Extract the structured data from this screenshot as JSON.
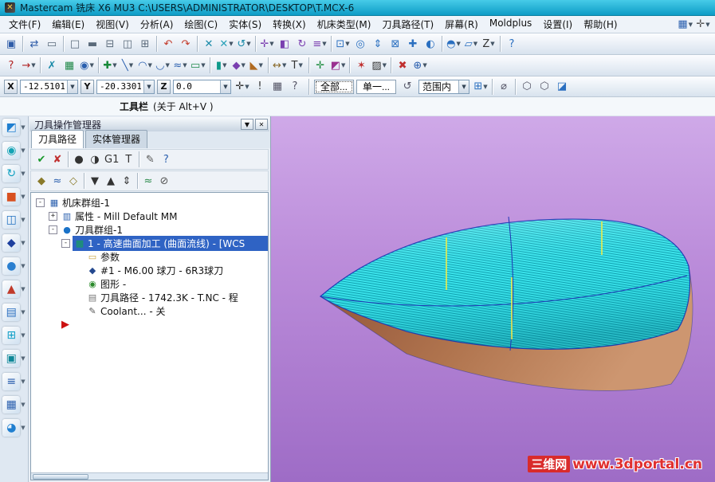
{
  "window": {
    "title": "Mastercam 铣床 X6 MU3  C:\\USERS\\ADMINISTRATOR\\DESKTOP\\T.MCX-6"
  },
  "menubar": {
    "items": [
      "文件(F)",
      "编辑(E)",
      "视图(V)",
      "分析(A)",
      "绘图(C)",
      "实体(S)",
      "转换(X)",
      "机床类型(M)",
      "刀具路径(T)",
      "屏幕(R)",
      "Moldplus",
      "设置(I)",
      "帮助(H)"
    ],
    "right_icons": [
      {
        "name": "toolbar-states",
        "glyph": "▦",
        "color": "#2a5fae",
        "dd": true
      },
      {
        "name": "customize",
        "glyph": "✛",
        "color": "#555",
        "dd": true
      }
    ]
  },
  "toolbar1": {
    "icons": [
      {
        "name": "save",
        "glyph": "▣",
        "color": "#2e5ca8"
      },
      {
        "sep": true
      },
      {
        "name": "file-convert",
        "glyph": "⇄",
        "color": "#2e5ca8"
      },
      {
        "name": "print",
        "glyph": "▭",
        "color": "#5a6a7a"
      },
      {
        "sep": true
      },
      {
        "name": "screen-clear",
        "glyph": "□",
        "color": "#5a6a7a"
      },
      {
        "name": "viewport-single",
        "glyph": "▬",
        "color": "#5a6a7a"
      },
      {
        "name": "viewport-split-h",
        "glyph": "⊟",
        "color": "#5a6a7a"
      },
      {
        "name": "viewport-split-v",
        "glyph": "◫",
        "color": "#5a6a7a"
      },
      {
        "name": "viewport-quad",
        "glyph": "⊞",
        "color": "#5a6a7a"
      },
      {
        "sep": true
      },
      {
        "name": "undo",
        "glyph": "↶",
        "color": "#c23a2a"
      },
      {
        "name": "redo",
        "glyph": "↷",
        "color": "#c23a2a"
      },
      {
        "sep": true
      },
      {
        "name": "delete-entities",
        "glyph": "✕",
        "color": "#1a8aa8"
      },
      {
        "name": "delete-duplicates",
        "glyph": "✕",
        "color": "#28a0b8",
        "dd": true
      },
      {
        "name": "undelete",
        "glyph": "↺",
        "color": "#1a8aa8",
        "dd": true
      },
      {
        "sep": true
      },
      {
        "name": "xform-translate",
        "glyph": "✛",
        "color": "#7a3fb0",
        "dd": true
      },
      {
        "name": "xform-mirror",
        "glyph": "◧",
        "color": "#7a3fb0"
      },
      {
        "name": "xform-rotate",
        "glyph": "↻",
        "color": "#7a3fb0"
      },
      {
        "name": "xform-offset",
        "glyph": "≡",
        "color": "#7a3fb0",
        "dd": true
      },
      {
        "sep": true
      },
      {
        "name": "zoom-window",
        "glyph": "⊡",
        "color": "#2a6fc0",
        "dd": true
      },
      {
        "name": "zoom-target",
        "glyph": "◎",
        "color": "#2a6fc0"
      },
      {
        "name": "zoom-in-out",
        "glyph": "⇕",
        "color": "#2a6fc0"
      },
      {
        "name": "zoom-fit",
        "glyph": "⊠",
        "color": "#2a6fc0"
      },
      {
        "name": "pan",
        "glyph": "✚",
        "color": "#2a6fc0"
      },
      {
        "name": "repaint",
        "glyph": "◐",
        "color": "#2a6fc0"
      },
      {
        "sep": true
      },
      {
        "name": "gview-combo",
        "glyph": "◓",
        "color": "#2a6fc0",
        "dd": true
      },
      {
        "name": "planes-combo",
        "glyph": "▱",
        "color": "#2a6fc0",
        "dd": true
      },
      {
        "name": "z-depth",
        "glyph": "Z",
        "color": "#333",
        "dd": true
      },
      {
        "sep": true
      },
      {
        "name": "help",
        "glyph": "?",
        "color": "#2a6fc0"
      }
    ]
  },
  "toolbar2": {
    "icons": [
      {
        "name": "analyze-position",
        "glyph": "?",
        "color": "#b02020"
      },
      {
        "name": "analyze-dynamic",
        "glyph": "→",
        "color": "#b02020",
        "dd": true
      },
      {
        "sep": true
      },
      {
        "name": "delete-entity",
        "glyph": "✗",
        "color": "#1a8aa8"
      },
      {
        "name": "select-result",
        "glyph": "▦",
        "color": "#238a4a"
      },
      {
        "name": "curve-edit",
        "glyph": "◉",
        "color": "#2a5fae",
        "dd": true
      },
      {
        "sep": true
      },
      {
        "name": "create-point",
        "glyph": "✚",
        "color": "#188a3a",
        "dd": true
      },
      {
        "name": "create-line",
        "glyph": "╲",
        "color": "#2a5fae",
        "dd": true
      },
      {
        "name": "create-arc",
        "glyph": "◠",
        "color": "#2a5fae",
        "dd": true
      },
      {
        "name": "create-fillet",
        "glyph": "◡",
        "color": "#2a5fae",
        "dd": true
      },
      {
        "name": "create-spline",
        "glyph": "≈",
        "color": "#2a5fae",
        "dd": true
      },
      {
        "name": "create-rectangle",
        "glyph": "▭",
        "color": "#1f8a4a",
        "dd": true
      },
      {
        "sep": true
      },
      {
        "name": "solid-extrude",
        "glyph": "▮",
        "color": "#0f9a8a",
        "dd": true
      },
      {
        "name": "surface-create",
        "glyph": "◆",
        "color": "#7a3fb0",
        "dd": true
      },
      {
        "name": "chamfer",
        "glyph": "◣",
        "color": "#b06a20",
        "dd": true
      },
      {
        "sep": true
      },
      {
        "name": "dimension",
        "glyph": "↔",
        "color": "#8a6a2a",
        "dd": true
      },
      {
        "name": "note-text",
        "glyph": "T",
        "color": "#333",
        "dd": true
      },
      {
        "sep": true
      },
      {
        "name": "wcs-origin",
        "glyph": "✛",
        "color": "#188a3a"
      },
      {
        "name": "attribute-style",
        "glyph": "◩",
        "color": "#9a3090",
        "dd": true
      },
      {
        "sep": true
      },
      {
        "name": "clear-colors",
        "glyph": "✶",
        "color": "#c03030"
      },
      {
        "name": "set-attributes",
        "glyph": "▨",
        "color": "#333",
        "dd": true
      },
      {
        "sep": true
      },
      {
        "name": "delete-color",
        "glyph": "✖",
        "color": "#c03030"
      },
      {
        "name": "more-tools",
        "glyph": "⊕",
        "color": "#2a5fae",
        "dd": true
      }
    ]
  },
  "coordbar": {
    "x_label": "X",
    "x": "-12.5101",
    "y_label": "Y",
    "y": "-20.3301",
    "z_label": "Z",
    "z": "0.0",
    "icons_mid": [
      {
        "name": "autocursor",
        "glyph": "✛",
        "color": "#333",
        "dd": true
      },
      {
        "name": "fast-point",
        "glyph": "!",
        "color": "#333"
      },
      {
        "name": "visual-cues",
        "glyph": "▦",
        "color": "#556"
      },
      {
        "name": "autocursor-help",
        "glyph": "?",
        "color": "#556"
      }
    ],
    "select_all": "全部...",
    "select_single": "单一...",
    "icons_sel": [
      {
        "name": "select-last",
        "glyph": "↺",
        "color": "#556"
      }
    ],
    "range_value": "范围内",
    "icons_right": [
      {
        "name": "select-mode",
        "glyph": "⊞",
        "color": "#2a6fc0",
        "dd": true
      },
      {
        "sep": true
      },
      {
        "name": "selection-validate",
        "glyph": "⌀",
        "color": "#556"
      },
      {
        "sep": true
      },
      {
        "name": "mask-wireframe",
        "glyph": "⬡",
        "color": "#556"
      },
      {
        "name": "mask-solids",
        "glyph": "⬡",
        "color": "#556"
      },
      {
        "name": "selection-grid",
        "glyph": "◪",
        "color": "#2a6fc0"
      }
    ]
  },
  "tooltipbar": {
    "title": "工具栏",
    "hint": "(关于 Alt+V )"
  },
  "leftstrip": {
    "tools": [
      {
        "name": "gview-isometric",
        "glyph": "◩",
        "color": "#1f7fd0"
      },
      {
        "name": "gview-dynamic",
        "glyph": "◉",
        "color": "#13a3b4"
      },
      {
        "name": "gview-rotate",
        "glyph": "↻",
        "color": "#0fa0c0"
      },
      {
        "name": "shading-toggle",
        "glyph": "■",
        "color": "#d85020"
      },
      {
        "name": "gview-top",
        "glyph": "◫",
        "color": "#1f6fc0"
      },
      {
        "name": "gview-front",
        "glyph": "◆",
        "color": "#1c3f9e"
      },
      {
        "name": "gview-right",
        "glyph": "●",
        "color": "#2a7fd0"
      },
      {
        "name": "cplane-select",
        "glyph": "▲",
        "color": "#c03a2a"
      },
      {
        "name": "levels-manager",
        "glyph": "▤",
        "color": "#2a6fc0"
      },
      {
        "name": "viewport-toggle",
        "glyph": "⊞",
        "color": "#12a0c8"
      },
      {
        "name": "material-display",
        "glyph": "▣",
        "color": "#108898"
      },
      {
        "name": "layers-stack",
        "glyph": "≡",
        "color": "#2a5fae"
      },
      {
        "name": "grid-toggle",
        "glyph": "▦",
        "color": "#2a5fae"
      },
      {
        "name": "extra-tool",
        "glyph": "◕",
        "color": "#1f7fd0"
      }
    ]
  },
  "opmgr": {
    "title": "刀具操作管理器",
    "dropdown_glyph": "▼",
    "close_glyph": "✕",
    "tabs": [
      {
        "label": "刀具路径",
        "active": true
      },
      {
        "label": "实体管理器",
        "active": false
      }
    ],
    "toolbar_row1": [
      {
        "name": "select-all-operations",
        "glyph": "✔",
        "color": "#18982a"
      },
      {
        "name": "reset-selection",
        "glyph": "✘",
        "color": "#c03030"
      },
      {
        "sep": true
      },
      {
        "name": "backplot-selected",
        "glyph": "●",
        "color": "#333"
      },
      {
        "name": "verify-selected",
        "glyph": "◑",
        "color": "#333"
      },
      {
        "name": "g1-check",
        "glyph": "G1",
        "color": "#333"
      },
      {
        "name": "post-selected",
        "glyph": "T",
        "color": "#333"
      },
      {
        "sep": true
      },
      {
        "name": "feed-optimize",
        "glyph": "✎",
        "color": "#555"
      },
      {
        "name": "operations-help",
        "glyph": "?",
        "color": "#2a5fae"
      }
    ],
    "toolbar_row2": [
      {
        "name": "lock-operation",
        "glyph": "◆",
        "color": "#8a7a2a"
      },
      {
        "name": "toggle-toolpath-lock",
        "glyph": "≈",
        "color": "#2a5fae"
      },
      {
        "name": "toggle-post",
        "glyph": "◇",
        "color": "#8a7a2a"
      },
      {
        "sep": true
      },
      {
        "name": "move-insert-down",
        "glyph": "▼",
        "color": "#333"
      },
      {
        "name": "move-insert-up",
        "glyph": "▲",
        "color": "#333"
      },
      {
        "name": "scroll-insert-arrow",
        "glyph": "⇕",
        "color": "#333"
      },
      {
        "sep": true
      },
      {
        "name": "toggle-display-selected",
        "glyph": "≈",
        "color": "#2a8a4a"
      },
      {
        "name": "single-display",
        "glyph": "⊘",
        "color": "#555"
      }
    ],
    "tree": [
      {
        "level": 0,
        "expander": "minus",
        "icon": "▦",
        "iconColor": "#2a5fae",
        "label": "机床群组-1"
      },
      {
        "level": 1,
        "expander": "plus",
        "icon": "▥",
        "iconColor": "#2a5fae",
        "label": "属性 - Mill Default MM"
      },
      {
        "level": 1,
        "expander": "minus",
        "icon": "●",
        "iconColor": "#1a72c8",
        "label": "刀具群组-1"
      },
      {
        "level": 2,
        "expander": "minus",
        "icon": "▩",
        "iconColor": "#17a05a",
        "label": "1 - 高速曲面加工 (曲面流线) - [WCS",
        "selected": true
      },
      {
        "level": 3,
        "icon": "▭",
        "iconColor": "#c9a43f",
        "label": "参数"
      },
      {
        "level": 3,
        "icon": "◆",
        "iconColor": "#23488e",
        "label": "#1 - M6.00 球刀 - 6R3球刀"
      },
      {
        "level": 3,
        "icon": "◉",
        "iconColor": "#2a8a2a",
        "label": "图形 -"
      },
      {
        "level": 3,
        "icon": "▤",
        "iconColor": "#777777",
        "label": "刀具路径 - 1742.3K - T.NC - 程"
      },
      {
        "level": 3,
        "icon": "✎",
        "iconColor": "#555555",
        "label": "Coolant... - 关"
      },
      {
        "level": 2,
        "arrow": true
      }
    ]
  },
  "viewport": {
    "watermark_brand": "三维网",
    "watermark_url": "www.3dportal.cn",
    "model": "boat-hull-flowline-toolpath",
    "colors": {
      "toolpath": "#3ce4ec",
      "toolpath_line": "#0b98a8",
      "hull_dark": "#8a4c34",
      "hull_light": "#c98f66",
      "wireframe": "#1f35b5",
      "markers": "#ecec4a",
      "bg_top": "#cfa9e8",
      "bg_bottom": "#9e6cc6"
    }
  }
}
